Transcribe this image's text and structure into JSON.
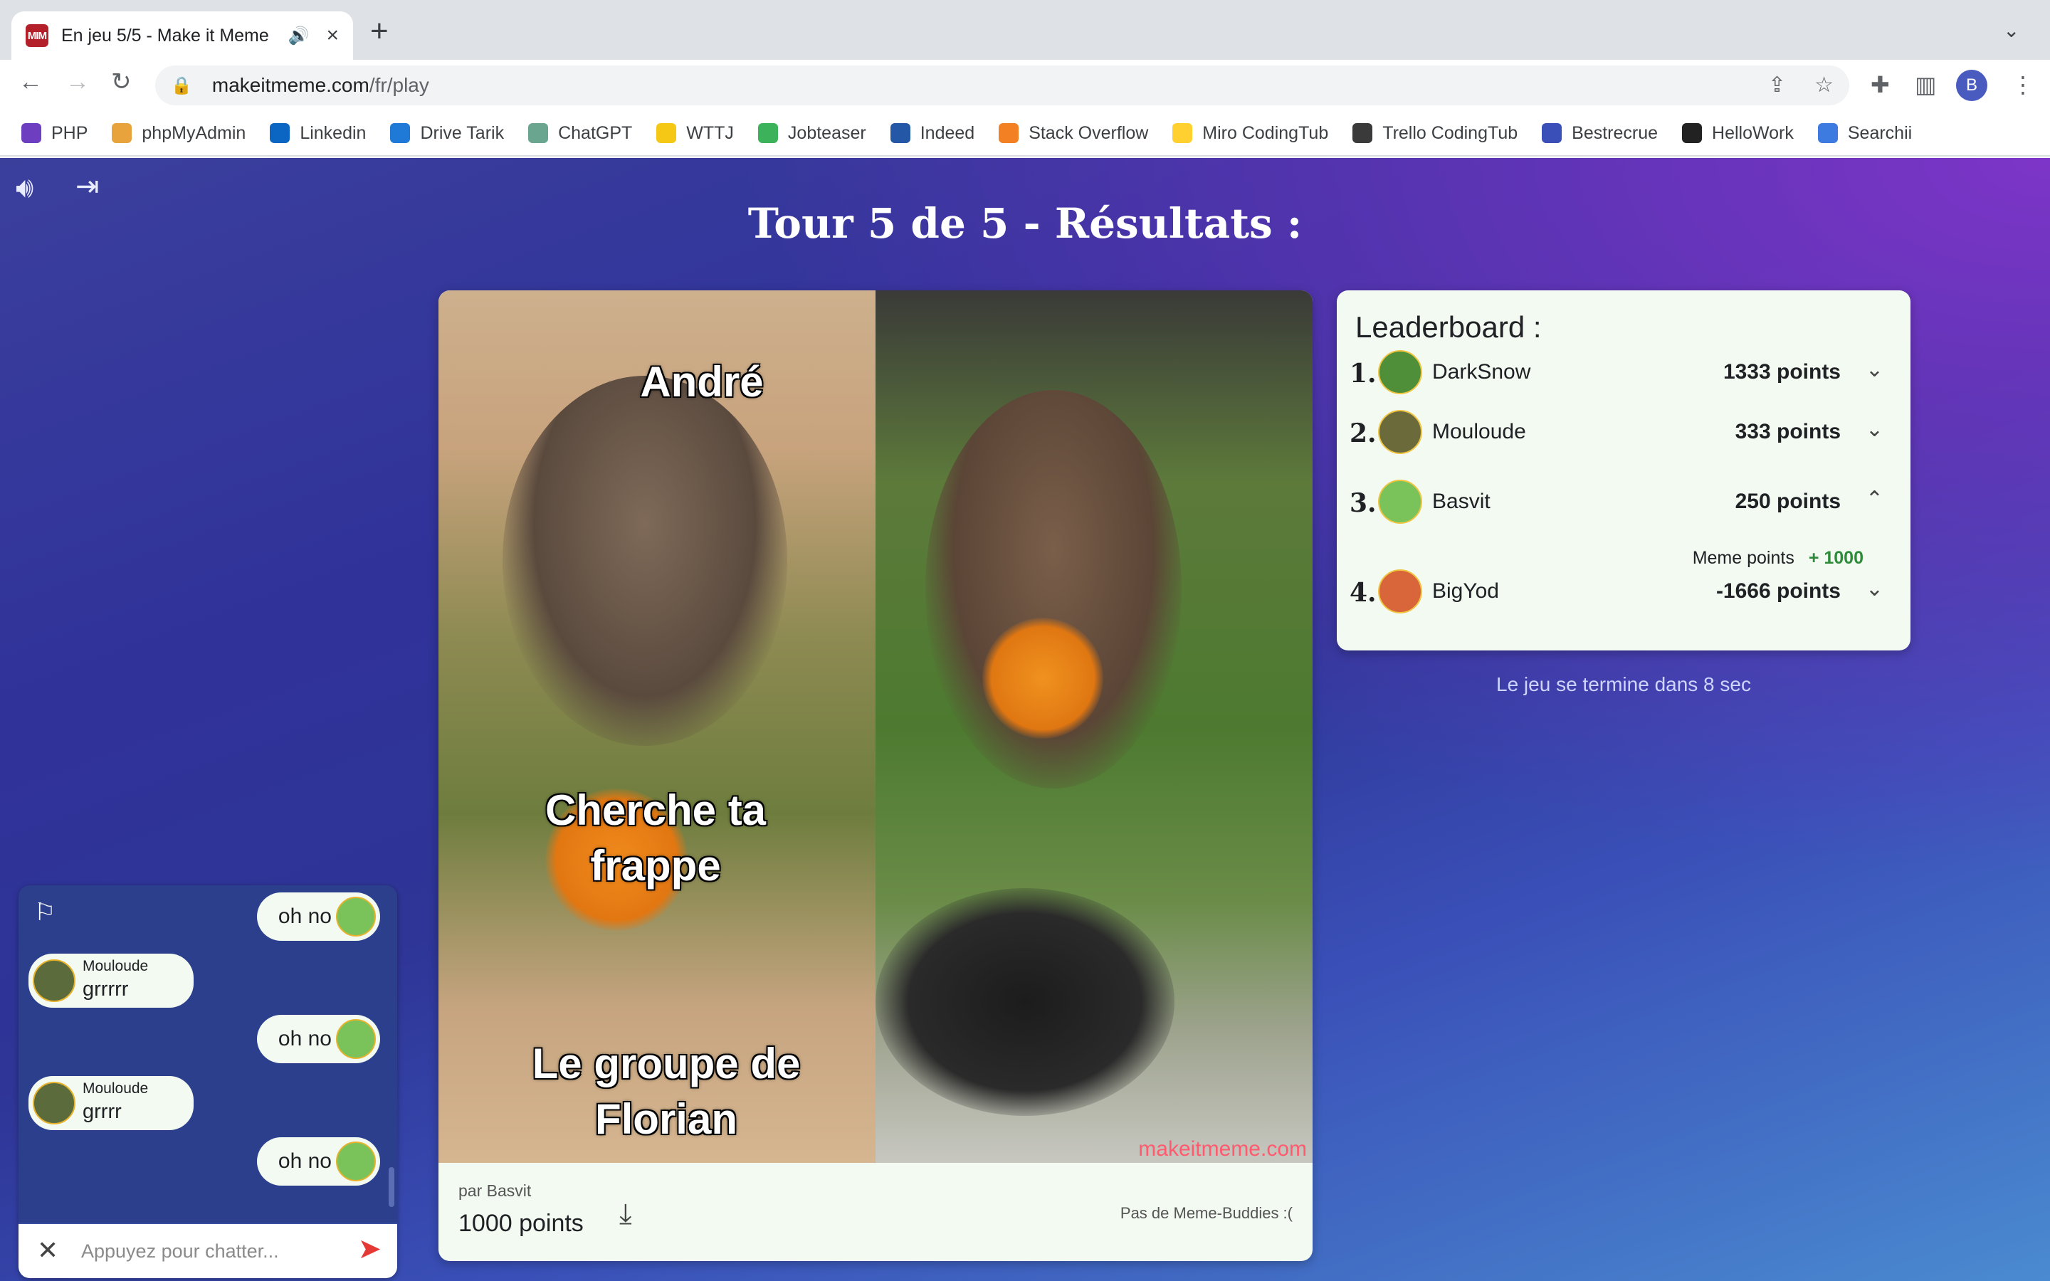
{
  "browser": {
    "tab_title": "En jeu 5/5 - Make it Meme",
    "tab_favicon_text": "MIM",
    "url_host": "makeitmeme.com",
    "url_path": "/fr/play",
    "profile_initial": "B",
    "bookmarks": [
      {
        "label": "PHP",
        "icon": "php-icon",
        "color": "#6d3fc0"
      },
      {
        "label": "phpMyAdmin",
        "icon": "phpmyadmin-icon",
        "color": "#e8a33d"
      },
      {
        "label": "Linkedin",
        "icon": "linkedin-icon",
        "color": "#0a66c2"
      },
      {
        "label": "Drive Tarik",
        "icon": "onedrive-icon",
        "color": "#1e7ad6"
      },
      {
        "label": "ChatGPT",
        "icon": "chatgpt-icon",
        "color": "#6aa58f"
      },
      {
        "label": "WTTJ",
        "icon": "wttj-icon",
        "color": "#f4c814"
      },
      {
        "label": "Jobteaser",
        "icon": "jobteaser-icon",
        "color": "#3cb35a"
      },
      {
        "label": "Indeed",
        "icon": "indeed-icon",
        "color": "#2557a7"
      },
      {
        "label": "Stack Overflow",
        "icon": "stackoverflow-icon",
        "color": "#f48024"
      },
      {
        "label": "Miro CodingTub",
        "icon": "miro-icon",
        "color": "#ffd02f"
      },
      {
        "label": "Trello CodingTub",
        "icon": "trello-icon",
        "color": "#3a3a3a"
      },
      {
        "label": "Bestrecrue",
        "icon": "bestrecrue-icon",
        "color": "#3a4fb8"
      },
      {
        "label": "HelloWork",
        "icon": "hellowork-icon",
        "color": "#222222"
      },
      {
        "label": "Searchii",
        "icon": "searchii-icon",
        "color": "#3d7be0"
      }
    ]
  },
  "game": {
    "round_title": "Tour 5 de 5 - Résultats :",
    "meme": {
      "caption_top": "André",
      "caption_middle": "Cherche ta frappe",
      "caption_bottom": "Le groupe de Florian",
      "watermark": "makeitmeme.com",
      "author": "par Basvit",
      "points": "1000 points",
      "buddies": "Pas de Meme-Buddies :("
    },
    "leaderboard": {
      "title": "Leaderboard :",
      "rows": [
        {
          "rank": "1.",
          "name": "DarkSnow",
          "points": "1333 points",
          "chevron": "⌄",
          "avatar_color": "#4f8f3a"
        },
        {
          "rank": "2.",
          "name": "Mouloude",
          "points": "333 points",
          "chevron": "⌄",
          "avatar_color": "#6b6a3b"
        },
        {
          "rank": "3.",
          "name": "Basvit",
          "points": "250 points",
          "chevron": "⌃",
          "avatar_color": "#7ac25a"
        },
        {
          "rank": "4.",
          "name": "BigYod",
          "points": "-1666 points",
          "chevron": "⌄",
          "avatar_color": "#d9663a"
        }
      ],
      "expanded_label": "Meme points",
      "expanded_value": "+ 1000"
    },
    "game_ends": "Le jeu se termine dans 8 sec",
    "chat": {
      "messages": [
        {
          "type": "out",
          "text": "oh no"
        },
        {
          "type": "in",
          "author": "Mouloude",
          "text": "grrrrr"
        },
        {
          "type": "out",
          "text": "oh no"
        },
        {
          "type": "in",
          "author": "Mouloude",
          "text": "grrrr"
        },
        {
          "type": "out",
          "text": "oh no"
        }
      ],
      "placeholder": "Appuyez pour chatter..."
    }
  }
}
